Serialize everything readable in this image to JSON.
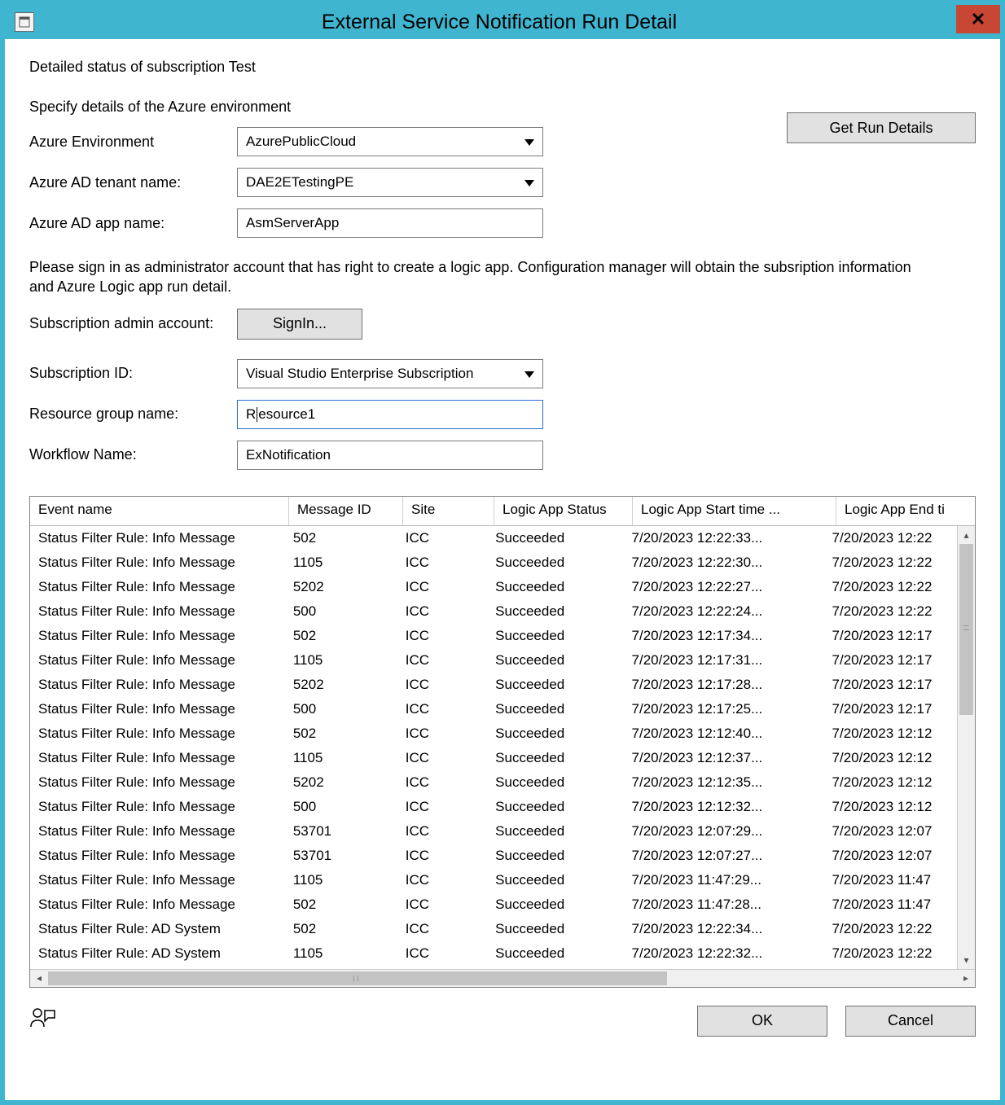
{
  "window": {
    "title": "External Service Notification Run Detail"
  },
  "heading": "Detailed status of subscription Test",
  "specify_label": "Specify details of the Azure environment",
  "get_details_btn": "Get Run Details",
  "fields": {
    "env_label": "Azure Environment",
    "env_value": "AzurePublicCloud",
    "tenant_label": "Azure AD tenant name:",
    "tenant_value": "DAE2ETestingPE",
    "app_label": "Azure AD app name:",
    "app_value": "AsmServerApp",
    "signin_note": "Please sign in as administrator account that has right to create a logic app. Configuration manager will obtain the subsription information and Azure Logic app run detail.",
    "admin_label": "Subscription admin account:",
    "signin_btn": "SignIn...",
    "subid_label": "Subscription ID:",
    "subid_value": "Visual Studio Enterprise Subscription",
    "rg_label": "Resource group name:",
    "rg_value_pre": "R",
    "rg_value_post": "esource1",
    "wf_label": "Workflow Name:",
    "wf_value": "ExNotification"
  },
  "grid": {
    "columns": {
      "event": "Event name",
      "msg": "Message ID",
      "site": "Site",
      "status": "Logic App Status",
      "start": "Logic App Start time ...",
      "end": "Logic App End ti"
    },
    "rows": [
      {
        "event": "Status Filter Rule: Info Message",
        "msg": "502",
        "site": "ICC",
        "status": "Succeeded",
        "start": "7/20/2023 12:22:33...",
        "end": "7/20/2023 12:22"
      },
      {
        "event": "Status Filter Rule: Info Message",
        "msg": "1105",
        "site": "ICC",
        "status": "Succeeded",
        "start": "7/20/2023 12:22:30...",
        "end": "7/20/2023 12:22"
      },
      {
        "event": "Status Filter Rule: Info Message",
        "msg": "5202",
        "site": "ICC",
        "status": "Succeeded",
        "start": "7/20/2023 12:22:27...",
        "end": "7/20/2023 12:22"
      },
      {
        "event": "Status Filter Rule: Info Message",
        "msg": "500",
        "site": "ICC",
        "status": "Succeeded",
        "start": "7/20/2023 12:22:24...",
        "end": "7/20/2023 12:22"
      },
      {
        "event": "Status Filter Rule: Info Message",
        "msg": "502",
        "site": "ICC",
        "status": "Succeeded",
        "start": "7/20/2023 12:17:34...",
        "end": "7/20/2023 12:17"
      },
      {
        "event": "Status Filter Rule: Info Message",
        "msg": "1105",
        "site": "ICC",
        "status": "Succeeded",
        "start": "7/20/2023 12:17:31...",
        "end": "7/20/2023 12:17"
      },
      {
        "event": "Status Filter Rule: Info Message",
        "msg": "5202",
        "site": "ICC",
        "status": "Succeeded",
        "start": "7/20/2023 12:17:28...",
        "end": "7/20/2023 12:17"
      },
      {
        "event": "Status Filter Rule: Info Message",
        "msg": "500",
        "site": "ICC",
        "status": "Succeeded",
        "start": "7/20/2023 12:17:25...",
        "end": "7/20/2023 12:17"
      },
      {
        "event": "Status Filter Rule: Info Message",
        "msg": "502",
        "site": "ICC",
        "status": "Succeeded",
        "start": "7/20/2023 12:12:40...",
        "end": "7/20/2023 12:12"
      },
      {
        "event": "Status Filter Rule: Info Message",
        "msg": "1105",
        "site": "ICC",
        "status": "Succeeded",
        "start": "7/20/2023 12:12:37...",
        "end": "7/20/2023 12:12"
      },
      {
        "event": "Status Filter Rule: Info Message",
        "msg": "5202",
        "site": "ICC",
        "status": "Succeeded",
        "start": "7/20/2023 12:12:35...",
        "end": "7/20/2023 12:12"
      },
      {
        "event": "Status Filter Rule: Info Message",
        "msg": "500",
        "site": "ICC",
        "status": "Succeeded",
        "start": "7/20/2023 12:12:32...",
        "end": "7/20/2023 12:12"
      },
      {
        "event": "Status Filter Rule: Info Message",
        "msg": "53701",
        "site": "ICC",
        "status": "Succeeded",
        "start": "7/20/2023 12:07:29...",
        "end": "7/20/2023 12:07"
      },
      {
        "event": "Status Filter Rule: Info Message",
        "msg": "53701",
        "site": "ICC",
        "status": "Succeeded",
        "start": "7/20/2023 12:07:27...",
        "end": "7/20/2023 12:07"
      },
      {
        "event": "Status Filter Rule: Info Message",
        "msg": "1105",
        "site": "ICC",
        "status": "Succeeded",
        "start": "7/20/2023 11:47:29...",
        "end": "7/20/2023 11:47"
      },
      {
        "event": "Status Filter Rule: Info Message",
        "msg": "502",
        "site": "ICC",
        "status": "Succeeded",
        "start": "7/20/2023 11:47:28...",
        "end": "7/20/2023 11:47"
      },
      {
        "event": "Status Filter Rule: AD System",
        "msg": "502",
        "site": "ICC",
        "status": "Succeeded",
        "start": "7/20/2023 12:22:34...",
        "end": "7/20/2023 12:22"
      },
      {
        "event": "Status Filter Rule: AD System",
        "msg": "1105",
        "site": "ICC",
        "status": "Succeeded",
        "start": "7/20/2023 12:22:32...",
        "end": "7/20/2023 12:22"
      }
    ]
  },
  "footer": {
    "ok": "OK",
    "cancel": "Cancel"
  }
}
